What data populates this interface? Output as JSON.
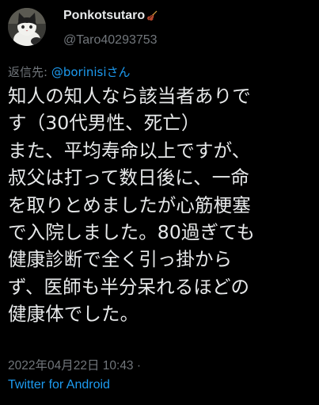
{
  "author": {
    "display_name": "Ponkotsutaro",
    "handle": "@Taro40293753",
    "badge_icon": "violin-icon",
    "avatar_icon": "cat-avatar"
  },
  "reply": {
    "prefix": "返信先: ",
    "mention": "@borinisiさん"
  },
  "body": {
    "lines": [
      "知人の知人なら該当者ありで",
      "す（30代男性、死亡）",
      "また、平均寿命以上ですが、",
      "叔父は打って数日後に、一命",
      "を取りとめましたが心筋梗塞",
      "で入院しました。80過ぎても",
      "健康診断で全く引っ掛から",
      "ず、医師も半分呆れるほどの",
      "健康体でした。"
    ]
  },
  "meta": {
    "timestamp": "2022年04月22日 10:43 ·",
    "source": "Twitter for Android"
  },
  "colors": {
    "background": "#000000",
    "text": "#e7e9ea",
    "secondary": "#71767b",
    "accent": "#1d9bf0"
  }
}
